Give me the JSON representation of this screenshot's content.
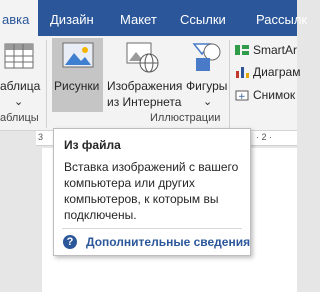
{
  "tabs": [
    {
      "label": "авка",
      "active": true
    },
    {
      "label": "Дизайн"
    },
    {
      "label": "Макет"
    },
    {
      "label": "Ссылки"
    },
    {
      "label": "Рассылк"
    }
  ],
  "ribbon": {
    "tables_group": {
      "button_label": "аблица",
      "group_label": "аблицы"
    },
    "illustrations_group": {
      "buttons": [
        {
          "label": "Рисунки"
        },
        {
          "label_line1": "Изображения",
          "label_line2": "из Интернета"
        },
        {
          "label": "Фигуры"
        }
      ],
      "group_label": "Иллюстрации"
    },
    "right_group": {
      "items": [
        "SmartAr",
        "Диаграм",
        "Снимок"
      ]
    }
  },
  "ruler": {
    "left_tick": "3",
    "right_tick": "· 2 ·"
  },
  "tooltip": {
    "title": "Из файла",
    "description": "Вставка изображений с вашего компьютера или других компьютеров, к которым вы подключены.",
    "help_link": "Дополнительные сведения",
    "help_icon": "?"
  },
  "colors": {
    "accent": "#2b579a",
    "ribbon_bg": "#f3f3f3",
    "selected_bg": "#c5c5c5"
  }
}
